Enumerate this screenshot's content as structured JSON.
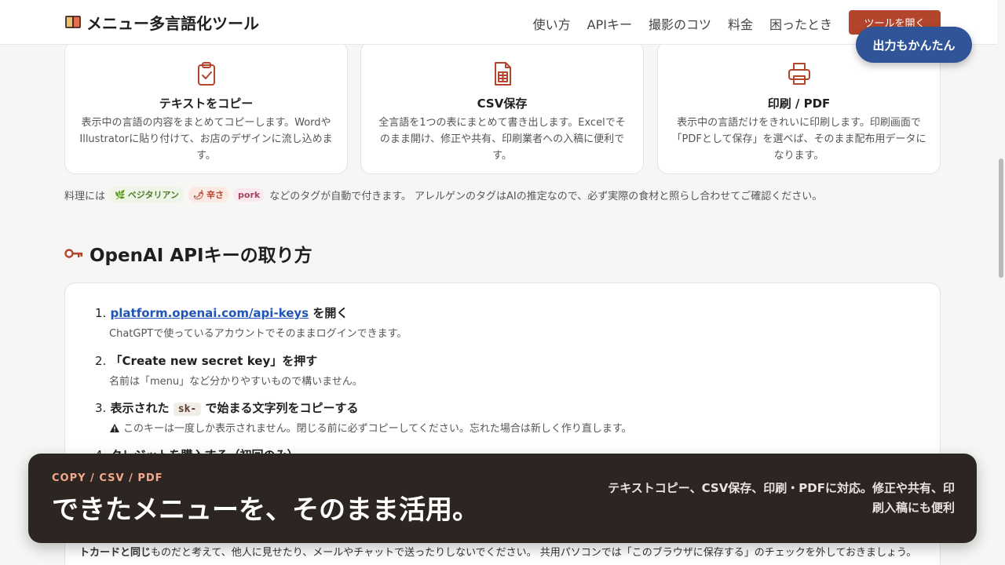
{
  "header": {
    "title": "メニュー多言語化ツール",
    "nav": [
      "使い方",
      "APIキー",
      "撮影のコツ",
      "料金",
      "困ったとき"
    ],
    "open_tool": "ツールを開く",
    "tip_pill": "出力もかんたん"
  },
  "cards": [
    {
      "icon": "clipboard-check-icon",
      "title": "テキストをコピー",
      "desc": "表示中の言語の内容をまとめてコピーします。WordやIllustratorに貼り付けて、お店のデザインに流し込めます。"
    },
    {
      "icon": "spreadsheet-file-icon",
      "title": "CSV保存",
      "desc": "全言語を1つの表にまとめて書き出します。Excelでそのまま開け、修正や共有、印刷業者への入稿に便利です。"
    },
    {
      "icon": "printer-icon",
      "title": "印刷 / PDF",
      "desc": "表示中の言語だけをきれいに印刷します。印刷画面で「PDFとして保存」を選べば、そのまま配布用データになります。"
    }
  ],
  "tags_line": {
    "prefix": "料理には",
    "tags": [
      "ベジタリアン",
      "辛さ",
      "pork"
    ],
    "suffix": "などのタグが自動で付きます。 アレルゲンのタグはAIの推定なので、必ず実際の食材と照らし合わせてご確認ください。"
  },
  "api_section": {
    "title": "OpenAI APIキーの取り方",
    "steps": [
      {
        "num": "1.",
        "link": "platform.openai.com/api-keys",
        "title_rest": " を開く",
        "sub": "ChatGPTで使っているアカウントでそのままログインできます。"
      },
      {
        "num": "2.",
        "title": "「Create new secret key」を押す",
        "sub": "名前は「menu」など分かりやすいもので構いません。"
      },
      {
        "num": "3.",
        "title_a": "表示された ",
        "code": "sk-",
        "title_b": " で始まる文字列をコピーする",
        "warn": "このキーは一度しか表示されません。閉じる前に必ずコピーしてください。忘れた場合は新しく作り直します。"
      },
      {
        "num": "4.",
        "title": "クレジットを購入する（初回のみ）"
      }
    ],
    "bottom_text_bold": "トカードと同じ",
    "bottom_text": "ものだと考えて、他人に見せたり、メールやチャットで送ったりしないでください。 共用パソコンでは「このブラウザに保存する」のチェックを外しておきましょう。"
  },
  "banner": {
    "kicker": "COPY / CSV / PDF",
    "headline": "できたメニューを、そのまま活用。",
    "desc": "テキストコピー、CSV保存、印刷・PDFに対応。修正や共有、印刷入稿にも便利"
  },
  "colors": {
    "accent": "#b2452b",
    "pill": "#2f5497",
    "banner_bg": "#2d2522",
    "link": "#1f55b5"
  }
}
